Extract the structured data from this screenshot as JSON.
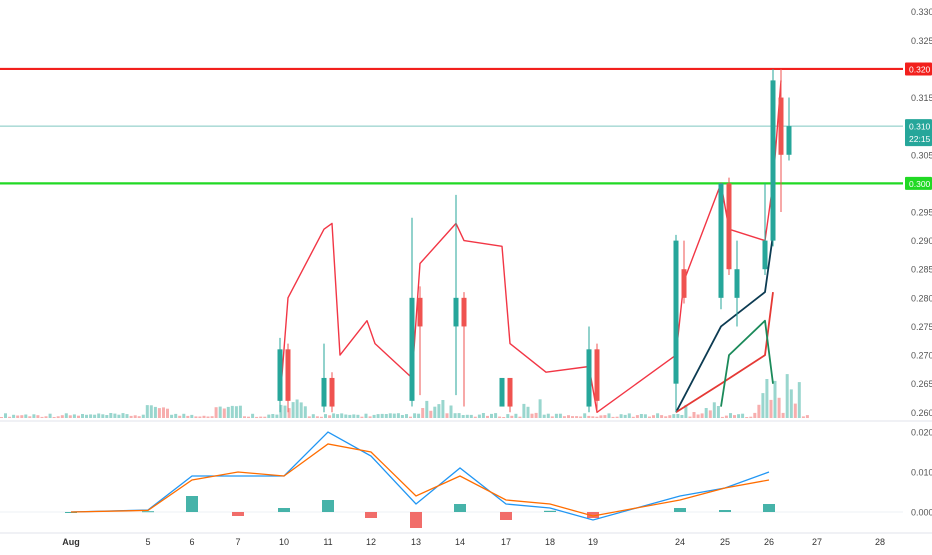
{
  "chart_data": [
    {
      "type": "candlestick",
      "x_ticks": [
        "Aug",
        "5",
        "6",
        "7",
        "10",
        "11",
        "12",
        "13",
        "14",
        "17",
        "18",
        "19",
        "24",
        "25",
        "26",
        "27",
        "28"
      ],
      "y_ticks": [
        "0.330",
        "0.325",
        "0.320",
        "0.315",
        "0.310",
        "0.305",
        "0.300",
        "0.295",
        "0.290",
        "0.285",
        "0.280",
        "0.275",
        "0.270",
        "0.265",
        "0.260"
      ],
      "ylim": [
        0.259,
        0.331
      ],
      "horizontal_lines": [
        {
          "value": 0.32,
          "label": "0.320",
          "color": "#f2201d"
        },
        {
          "value": 0.3,
          "label": "0.300",
          "color": "#21d924"
        }
      ],
      "last_price": {
        "value": 0.31,
        "label": "0.310",
        "countdown": "22:15",
        "color": "#26a69a"
      },
      "candles": [
        {
          "x": "10",
          "open": 0.262,
          "close": 0.271,
          "high": 0.273,
          "low": 0.26
        },
        {
          "x": "10",
          "open": 0.271,
          "close": 0.262,
          "high": 0.272,
          "low": 0.26
        },
        {
          "x": "11",
          "open": 0.261,
          "close": 0.266,
          "high": 0.272,
          "low": 0.26
        },
        {
          "x": "11",
          "open": 0.266,
          "close": 0.261,
          "high": 0.267,
          "low": 0.26
        },
        {
          "x": "13",
          "open": 0.262,
          "close": 0.28,
          "high": 0.294,
          "low": 0.261
        },
        {
          "x": "13",
          "open": 0.28,
          "close": 0.275,
          "high": 0.282,
          "low": 0.263
        },
        {
          "x": "14",
          "open": 0.275,
          "close": 0.28,
          "high": 0.298,
          "low": 0.263
        },
        {
          "x": "14",
          "open": 0.28,
          "close": 0.275,
          "high": 0.281,
          "low": 0.261
        },
        {
          "x": "17",
          "open": 0.261,
          "close": 0.266,
          "high": 0.266,
          "low": 0.261
        },
        {
          "x": "17",
          "open": 0.266,
          "close": 0.261,
          "high": 0.266,
          "low": 0.26
        },
        {
          "x": "19",
          "open": 0.261,
          "close": 0.271,
          "high": 0.275,
          "low": 0.26
        },
        {
          "x": "19",
          "open": 0.271,
          "close": 0.262,
          "high": 0.272,
          "low": 0.26
        },
        {
          "x": "24",
          "open": 0.265,
          "close": 0.29,
          "high": 0.291,
          "low": 0.26
        },
        {
          "x": "24",
          "open": 0.285,
          "close": 0.28,
          "high": 0.29,
          "low": 0.279
        },
        {
          "x": "25",
          "open": 0.28,
          "close": 0.3,
          "high": 0.3,
          "low": 0.278
        },
        {
          "x": "25",
          "open": 0.3,
          "close": 0.285,
          "high": 0.301,
          "low": 0.284
        },
        {
          "x": "25",
          "open": 0.28,
          "close": 0.285,
          "high": 0.29,
          "low": 0.275
        },
        {
          "x": "26",
          "open": 0.285,
          "close": 0.29,
          "high": 0.3,
          "low": 0.284
        },
        {
          "x": "26",
          "open": 0.29,
          "close": 0.318,
          "high": 0.32,
          "low": 0.289
        },
        {
          "x": "26",
          "open": 0.315,
          "close": 0.305,
          "high": 0.32,
          "low": 0.295
        },
        {
          "x": "26",
          "open": 0.305,
          "close": 0.31,
          "high": 0.315,
          "low": 0.304
        }
      ],
      "moving_averages": [
        {
          "color": "#f23645",
          "points": [
            {
              "x": "10",
              "y": 0.262
            },
            {
              "x": "10",
              "y": 0.28
            },
            {
              "x": "11",
              "y": 0.292
            },
            {
              "x": "11",
              "y": 0.293
            },
            {
              "x": "11",
              "y": 0.27
            },
            {
              "x": "12",
              "y": 0.276
            },
            {
              "x": "12",
              "y": 0.272
            },
            {
              "x": "13",
              "y": 0.266
            },
            {
              "x": "13",
              "y": 0.286
            },
            {
              "x": "14",
              "y": 0.293
            },
            {
              "x": "14",
              "y": 0.29
            },
            {
              "x": "17",
              "y": 0.289
            },
            {
              "x": "17",
              "y": 0.272
            },
            {
              "x": "18",
              "y": 0.267
            },
            {
              "x": "19",
              "y": 0.268
            },
            {
              "x": "19",
              "y": 0.26
            },
            {
              "x": "24",
              "y": 0.27
            },
            {
              "x": "24",
              "y": 0.283
            },
            {
              "x": "25",
              "y": 0.3
            },
            {
              "x": "25",
              "y": 0.292
            },
            {
              "x": "26",
              "y": 0.29
            },
            {
              "x": "26",
              "y": 0.3
            },
            {
              "x": "26",
              "y": 0.318
            }
          ]
        },
        {
          "color": "#0c3b52",
          "points": [
            {
              "x": "24",
              "y": 0.26
            },
            {
              "x": "25",
              "y": 0.275
            },
            {
              "x": "26",
              "y": 0.281
            },
            {
              "x": "26",
              "y": 0.291
            }
          ]
        },
        {
          "color": "#e53935",
          "points": [
            {
              "x": "24",
              "y": 0.26
            },
            {
              "x": "25",
              "y": 0.265
            },
            {
              "x": "26",
              "y": 0.27
            },
            {
              "x": "26",
              "y": 0.281
            }
          ]
        },
        {
          "color": "#1b8a5a",
          "points": [
            {
              "x": "25",
              "y": 0.261
            },
            {
              "x": "25",
              "y": 0.27
            },
            {
              "x": "26",
              "y": 0.276
            },
            {
              "x": "26",
              "y": 0.265
            }
          ]
        }
      ]
    },
    {
      "type": "macd",
      "y_ticks": [
        "0.020",
        "0.010",
        "0.000"
      ],
      "ylim": [
        -0.0045,
        0.022
      ],
      "x": [
        "Aug",
        "5",
        "6",
        "7",
        "10",
        "11",
        "12",
        "13",
        "14",
        "17",
        "18",
        "19",
        "24",
        "25",
        "26"
      ],
      "macd": [
        0.0,
        0.0005,
        0.009,
        0.009,
        0.009,
        0.02,
        0.014,
        0.002,
        0.011,
        0.002,
        0.001,
        -0.002,
        0.004,
        0.006,
        0.01
      ],
      "signal": [
        0.0,
        0.0004,
        0.008,
        0.01,
        0.009,
        0.017,
        0.015,
        0.004,
        0.009,
        0.003,
        0.002,
        -0.001,
        0.003,
        0.006,
        0.008
      ],
      "histogram": [
        0.0,
        0.0002,
        0.004,
        -0.001,
        0.001,
        0.003,
        -0.0015,
        -0.004,
        0.002,
        -0.002,
        0.0003,
        -0.0015,
        0.001,
        0.0005,
        0.002
      ]
    }
  ]
}
